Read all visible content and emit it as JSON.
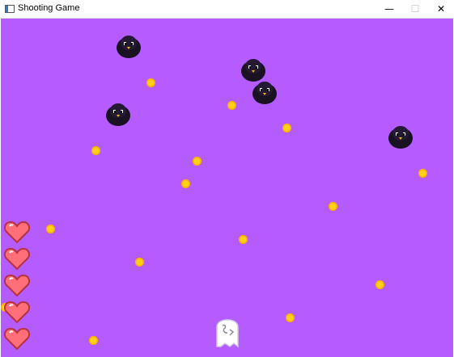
{
  "window": {
    "title": "Shooting Game",
    "controls": {
      "minimize": "—",
      "maximize": "☐",
      "close": "✕"
    }
  },
  "game": {
    "background_color": "#b45cff",
    "lives": 5,
    "enemy_icon": "crow-enemy-icon",
    "player_icon": "ghost-player-icon",
    "life_icon": "heart-icon",
    "bullet_icon": "fireball-icon",
    "enemy_count": 5,
    "bullet_count": 15
  }
}
